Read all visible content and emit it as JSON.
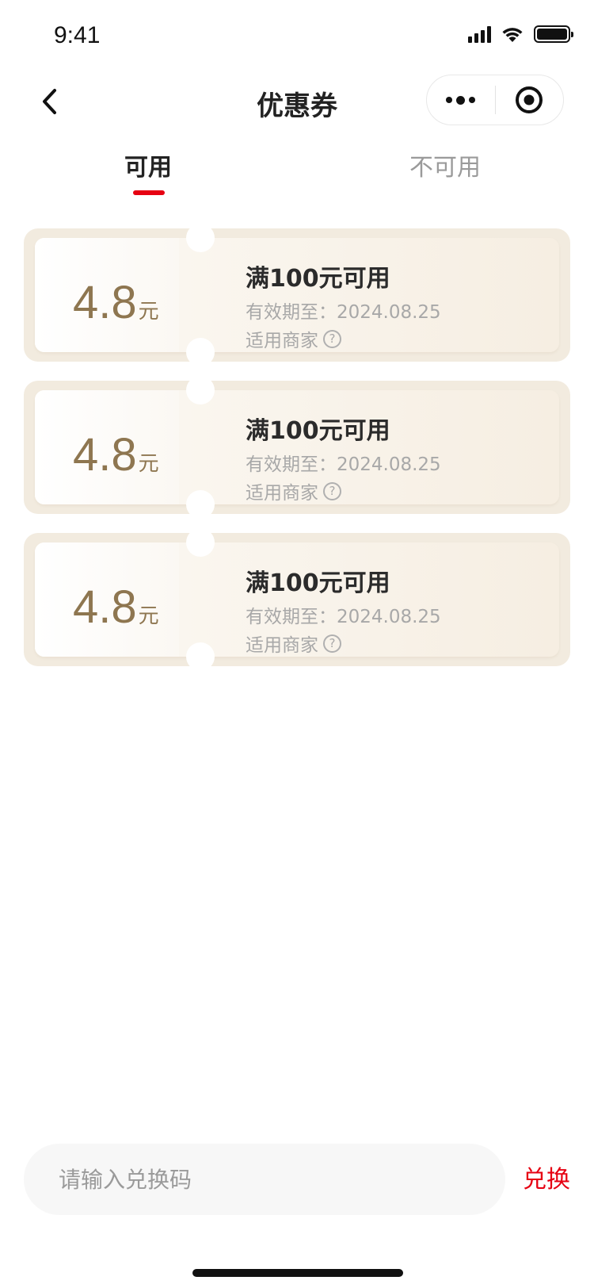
{
  "status_bar": {
    "time": "9:41"
  },
  "nav": {
    "title": "优惠券"
  },
  "tabs": [
    {
      "label": "可用",
      "active": true
    },
    {
      "label": "不可用",
      "active": false
    }
  ],
  "coupons": [
    {
      "amount": "4.8",
      "unit": "元",
      "title": "满100元可用",
      "expire": "有效期至：2024.08.25",
      "merchant_label": "适用商家"
    },
    {
      "amount": "4.8",
      "unit": "元",
      "title": "满100元可用",
      "expire": "有效期至：2024.08.25",
      "merchant_label": "适用商家"
    },
    {
      "amount": "4.8",
      "unit": "元",
      "title": "满100元可用",
      "expire": "有效期至：2024.08.25",
      "merchant_label": "适用商家"
    }
  ],
  "redeem": {
    "placeholder": "请输入兑换码",
    "button_label": "兑换"
  },
  "colors": {
    "accent": "#e60012",
    "coupon_amount": "#8e7650",
    "coupon_bg": "#f2ebdf"
  }
}
